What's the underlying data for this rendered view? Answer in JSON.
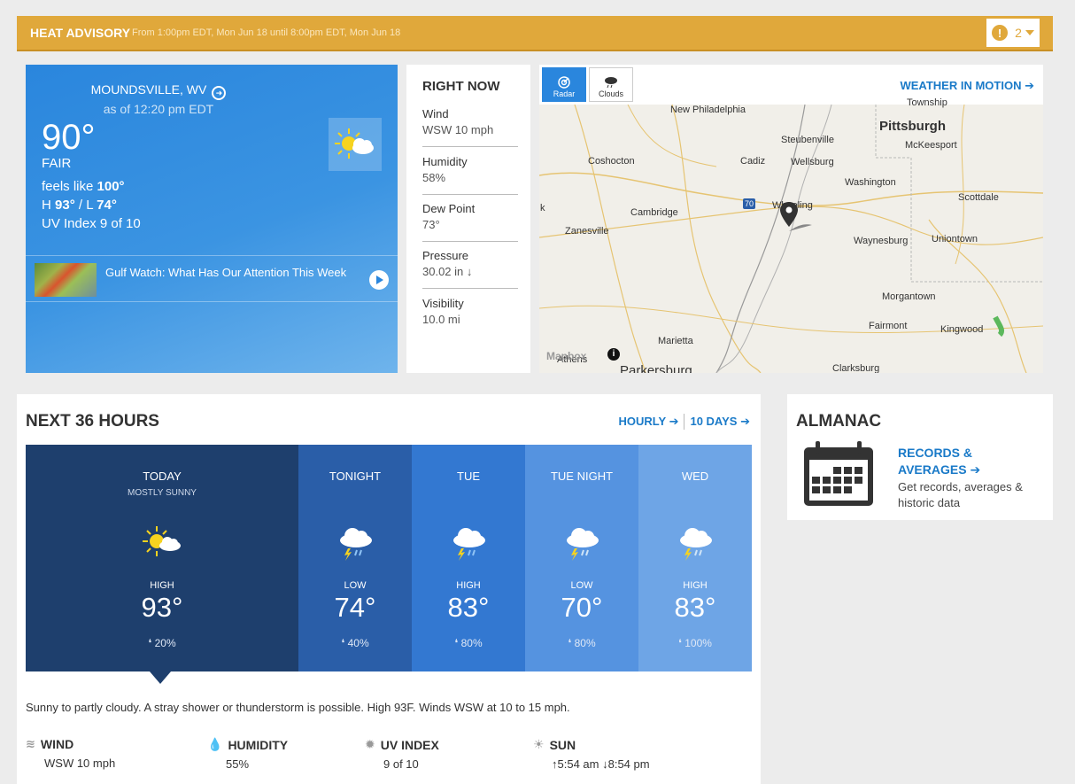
{
  "alert": {
    "title": "HEAT ADVISORY",
    "subtitle": "From 1:00pm EDT, Mon Jun 18 until 8:00pm EDT, Mon Jun 18",
    "count": "2"
  },
  "current": {
    "location": "MOUNDSVILLE, WV",
    "as_of": "as of 12:20 pm EDT",
    "temp": "90°",
    "condition": "FAIR",
    "feels_prefix": "feels like",
    "feels_value": "100°",
    "hilo_prefix": "H",
    "hilo_hi": "93°",
    "hilo_sep": " / L",
    "hilo_lo": "74°",
    "uv": "UV Index 9 of 10",
    "video_title": "Gulf Watch: What Has Our Attention This Week"
  },
  "right_now": {
    "title": "RIGHT NOW",
    "items": [
      {
        "label": "Wind",
        "value": "WSW 10 mph"
      },
      {
        "label": "Humidity",
        "value": "58%"
      },
      {
        "label": "Dew Point",
        "value": "73°"
      },
      {
        "label": "Pressure",
        "value": "30.02 in ↓"
      },
      {
        "label": "Visibility",
        "value": "10.0 mi"
      }
    ]
  },
  "map": {
    "tabs": [
      {
        "label": "Radar"
      },
      {
        "label": "Clouds"
      }
    ],
    "motion_link": "WEATHER IN MOTION",
    "attribution": "Mapbox",
    "cities": [
      "New Philadelphia",
      "Steubenville",
      "Pittsburgh",
      "McKeesport",
      "Coshocton",
      "Cadiz",
      "Wellsburg",
      "Washington",
      "Scottdale",
      "Cambridge",
      "Wheeling",
      "Zanesville",
      "Waynesburg",
      "Uniontown",
      "Morgantown",
      "Fairmont",
      "Kingwood",
      "Marietta",
      "Athens",
      "Parkersburg",
      "Clarksburg",
      "k",
      "Township",
      "70"
    ]
  },
  "next36": {
    "title": "NEXT 36 HOURS",
    "hourly_link": "HOURLY",
    "tenday_link": "10 DAYS",
    "periods": [
      {
        "name": "TODAY",
        "cond": "MOSTLY SUNNY",
        "hl": "HIGH",
        "temp": "93°",
        "precip": "20%",
        "icon": "sun-cloud",
        "color": "#1e3f6d"
      },
      {
        "name": "TONIGHT",
        "cond": "",
        "hl": "LOW",
        "temp": "74°",
        "precip": "40%",
        "icon": "thunderstorm",
        "color": "#2a5ea8"
      },
      {
        "name": "TUE",
        "cond": "",
        "hl": "HIGH",
        "temp": "83°",
        "precip": "80%",
        "icon": "thunderstorm",
        "color": "#3378d1"
      },
      {
        "name": "TUE NIGHT",
        "cond": "",
        "hl": "LOW",
        "temp": "70°",
        "precip": "80%",
        "icon": "thunderstorm",
        "color": "#5593e0"
      },
      {
        "name": "WED",
        "cond": "",
        "hl": "HIGH",
        "temp": "83°",
        "precip": "100%",
        "icon": "thunderstorm",
        "color": "#6ea5e6"
      }
    ],
    "narrative": "Sunny to partly cloudy. A stray shower or thunderstorm is possible. High 93F. Winds WSW at 10 to 15 mph.",
    "details": {
      "wind_label": "WIND",
      "wind_value": "WSW 10 mph",
      "humidity_label": "HUMIDITY",
      "humidity_value": "55%",
      "uv_label": "UV INDEX",
      "uv_value": "9 of 10",
      "sun_label": "SUN",
      "sunrise": "5:54 am",
      "sunset": "8:54 pm"
    }
  },
  "almanac": {
    "title": "ALMANAC",
    "link": "RECORDS & AVERAGES",
    "desc": "Get records, averages & historic data"
  }
}
